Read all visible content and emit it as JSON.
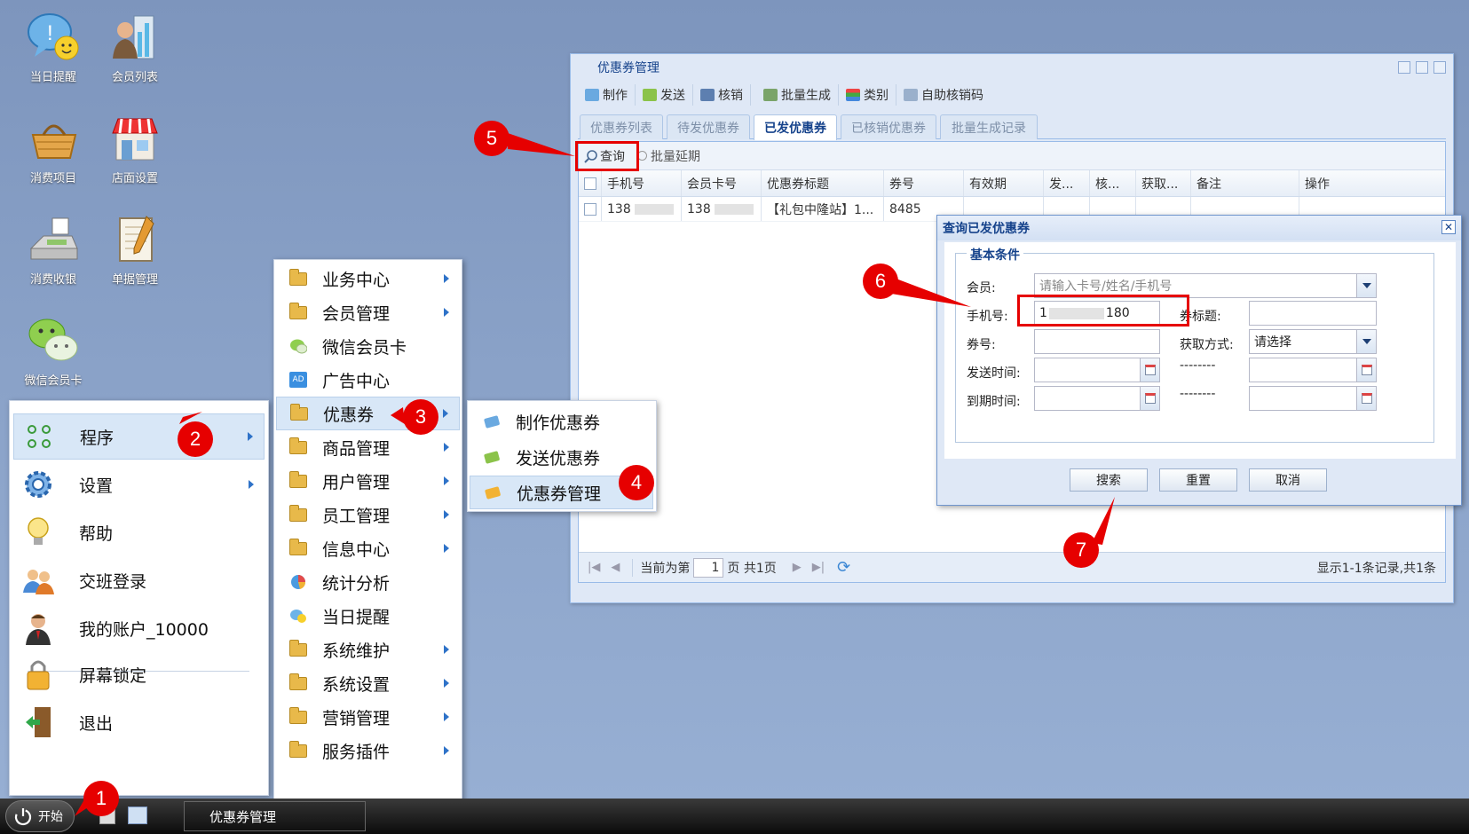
{
  "desktop_icons": [
    {
      "label": "当日提醒",
      "icon": "reminder-icon"
    },
    {
      "label": "会员列表",
      "icon": "member-list-icon"
    },
    {
      "label": "消费项目",
      "icon": "basket-icon"
    },
    {
      "label": "店面设置",
      "icon": "shop-icon"
    },
    {
      "label": "消费收银",
      "icon": "cash-register-icon"
    },
    {
      "label": "单据管理",
      "icon": "notepad-icon"
    },
    {
      "label": "微信会员卡",
      "icon": "wechat-icon"
    }
  ],
  "start_menu": {
    "items": [
      {
        "label": "程序",
        "icon": "apps-grid-icon"
      },
      {
        "label": "设置",
        "icon": "gear-icon"
      },
      {
        "label": "帮助",
        "icon": "lightbulb-icon"
      },
      {
        "label": "交班登录",
        "icon": "users-swap-icon"
      },
      {
        "label": "我的账户_10000",
        "icon": "user-account-icon"
      },
      {
        "label": "屏幕锁定",
        "icon": "lock-icon"
      },
      {
        "label": "退出",
        "icon": "exit-door-icon"
      }
    ]
  },
  "program_menu": {
    "items": [
      {
        "label": "业务中心",
        "icon": "folder-icon"
      },
      {
        "label": "会员管理",
        "icon": "folder-icon"
      },
      {
        "label": "微信会员卡",
        "icon": "wechat-icon"
      },
      {
        "label": "广告中心",
        "icon": "ad-icon"
      },
      {
        "label": "优惠券",
        "icon": "folder-icon"
      },
      {
        "label": "商品管理",
        "icon": "folder-icon"
      },
      {
        "label": "用户管理",
        "icon": "folder-icon"
      },
      {
        "label": "员工管理",
        "icon": "folder-icon"
      },
      {
        "label": "信息中心",
        "icon": "folder-icon"
      },
      {
        "label": "统计分析",
        "icon": "pie-chart-icon"
      },
      {
        "label": "当日提醒",
        "icon": "reminder-icon"
      },
      {
        "label": "系统维护",
        "icon": "folder-icon"
      },
      {
        "label": "系统设置",
        "icon": "folder-icon"
      },
      {
        "label": "营销管理",
        "icon": "folder-icon"
      },
      {
        "label": "服务插件",
        "icon": "folder-icon"
      }
    ]
  },
  "coupon_menu": {
    "items": [
      {
        "label": "制作优惠券",
        "icon": "make-coupon-icon"
      },
      {
        "label": "发送优惠券",
        "icon": "send-coupon-icon"
      },
      {
        "label": "优惠券管理",
        "icon": "coupon-manage-icon"
      }
    ]
  },
  "taskbar": {
    "start_label": "开始",
    "task_label": "优惠券管理"
  },
  "window": {
    "title": "优惠券管理",
    "toolbar": [
      "制作",
      "发送",
      "核销",
      "批量生成",
      "类别",
      "自助核销码"
    ],
    "tabs": [
      "优惠券列表",
      "待发优惠券",
      "已发优惠券",
      "已核销优惠券",
      "批量生成记录"
    ],
    "active_tab": "已发优惠券",
    "grid_toolbar": {
      "query": "查询",
      "extend": "批量延期"
    },
    "columns": [
      "手机号",
      "会员卡号",
      "优惠券标题",
      "券号",
      "有效期",
      "发...",
      "核...",
      "获取...",
      "备注",
      "操作"
    ],
    "rows": [
      {
        "phone": "138",
        "card": "138",
        "title": "【礼包中隆站】1...",
        "code": "8485"
      }
    ],
    "pager": {
      "prefix": "当前为第",
      "page": "1",
      "suffix": "页 共1页",
      "summary": "显示1-1条记录,共1条"
    }
  },
  "dialog": {
    "title": "查询已发优惠券",
    "section": "基本条件",
    "fields": {
      "member_label": "会员:",
      "member_placeholder": "请输入卡号/姓名/手机号",
      "phone_label": "手机号:",
      "phone_value": "1",
      "phone_value_tail": "180",
      "coupon_title_label": "券标题:",
      "code_label": "券号:",
      "method_label": "获取方式:",
      "method_value": "请选择",
      "send_time_label": "发送时间:",
      "expire_time_label": "到期时间:",
      "range_sep": "--------"
    },
    "buttons": {
      "search": "搜索",
      "reset": "重置",
      "cancel": "取消"
    }
  },
  "annotations": [
    "1",
    "2",
    "3",
    "4",
    "5",
    "6",
    "7"
  ],
  "colors": {
    "annotation": "#e60000",
    "title_blue": "#15428b",
    "menu_highlight": "#d8e7f7"
  }
}
